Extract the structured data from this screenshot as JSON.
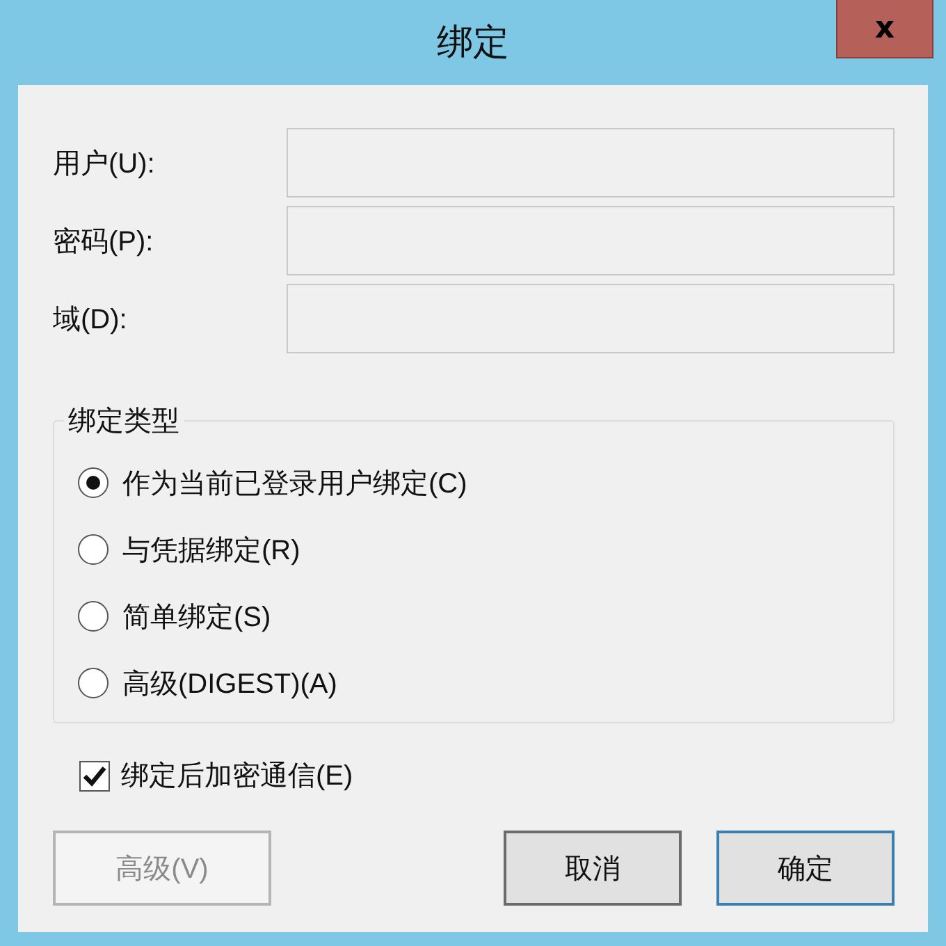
{
  "window": {
    "title": "绑定",
    "close": "x"
  },
  "fields": [
    {
      "label": "用户(U):"
    },
    {
      "label": "密码(P):"
    },
    {
      "label": "域(D):"
    }
  ],
  "group": {
    "title": "绑定类型",
    "options": [
      {
        "label": "作为当前已登录用户绑定(C)",
        "selected": true
      },
      {
        "label": "与凭据绑定(R)",
        "selected": false
      },
      {
        "label": "简单绑定(S)",
        "selected": false
      },
      {
        "label": "高级(DIGEST)(A)",
        "selected": false
      }
    ]
  },
  "encrypt": {
    "label": "绑定后加密通信(E)",
    "checked": true
  },
  "buttons": [
    {
      "label": "高级(V)",
      "disabled": true,
      "default": false
    },
    {
      "label": "取消",
      "disabled": false,
      "default": false
    },
    {
      "label": "确定",
      "disabled": false,
      "default": true
    }
  ]
}
